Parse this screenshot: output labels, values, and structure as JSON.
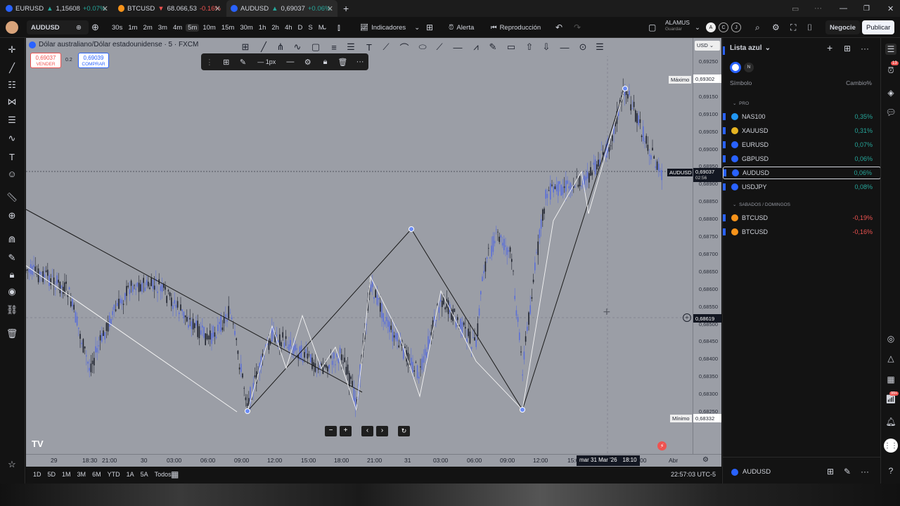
{
  "browser_tabs": [
    {
      "symbol": "EURUSD",
      "arrow": "▲",
      "price": "1,15608",
      "change": "+0.07%",
      "dir": "up"
    },
    {
      "symbol": "BTCUSD",
      "arrow": "▼",
      "price": "68.066,53",
      "change": "-0.16%",
      "dir": "down"
    },
    {
      "symbol": "AUDUSD",
      "arrow": "▲",
      "price": "0,69037",
      "change": "+0.06%",
      "dir": "up"
    }
  ],
  "toolbar": {
    "symbol": "AUDUSD",
    "timeframes": [
      "30s",
      "1m",
      "2m",
      "3m",
      "4m",
      "5m",
      "10m",
      "15m",
      "30m",
      "1h",
      "2h",
      "4h",
      "D",
      "S",
      "M"
    ],
    "selected_timeframe": "5m",
    "indicators_label": "Indicadores",
    "alert_label": "Alerta",
    "replay_label": "Reproducción",
    "layout_name": "ALAMUS",
    "layout_sub": "Guardar",
    "trade_label": "Negocie",
    "publish_label": "Publicar"
  },
  "chart": {
    "title": "Dólar australiano/Dólar estadounidense · 5 · FXCM",
    "sell_price": "0,69037",
    "sell_label": "VENDER",
    "spread": "0.2",
    "buy_price": "0,69039",
    "buy_label": "COMPRAR",
    "currency": "USD",
    "max_label": "Máximo",
    "max_value": "0,69302",
    "min_label": "Mínimo",
    "min_value": "0,68332",
    "current_symbol": "AUDUSD",
    "current_price": "0,69037",
    "countdown": "02:56",
    "crosshair_price": "0,68619",
    "line_width_label": "1px",
    "price_labels": [
      "0,69250",
      "0,69200",
      "0,69150",
      "0,69100",
      "0,69050",
      "0,69000",
      "0,68950",
      "0,68900",
      "0,68850",
      "0,68800",
      "0,68750",
      "0,68700",
      "0,68650",
      "0,68600",
      "0,68550",
      "0,68500",
      "0,68450",
      "0,68400",
      "0,68350",
      "0,68300",
      "0,68250"
    ],
    "time_labels": [
      "29",
      "18:30",
      "21:00",
      "30",
      "03:00",
      "06:00",
      "09:00",
      "12:00",
      "15:00",
      "18:00",
      "21:00",
      "31",
      "03:00",
      "06:00",
      "09:00",
      "12:00",
      "15:0",
      "00",
      "Abr"
    ],
    "crosshair_time": "mar 31 Mar '26",
    "crosshair_clock": "18:10"
  },
  "bottombar": {
    "ranges": [
      "1D",
      "5D",
      "1M",
      "3M",
      "6M",
      "YTD",
      "1A",
      "5A",
      "Todos"
    ],
    "clock": "22:57:03 UTC-5"
  },
  "watchlist": {
    "title": "Lista azul",
    "col_symbol": "Símbolo",
    "col_change": "Cambio%",
    "section1": "PRO",
    "section2": "SABADOS / DOMINGOS",
    "items": [
      {
        "symbol": "NAS100",
        "change": "0,35%",
        "dir": "up",
        "color": "#2196f3"
      },
      {
        "symbol": "XAUUSD",
        "change": "0,31%",
        "dir": "up",
        "color": "#e6b422"
      },
      {
        "symbol": "EURUSD",
        "change": "0,07%",
        "dir": "up",
        "color": "#2962ff"
      },
      {
        "symbol": "GBPUSD",
        "change": "0,06%",
        "dir": "up",
        "color": "#2962ff"
      },
      {
        "symbol": "AUDUSD",
        "change": "0,06%",
        "dir": "up",
        "color": "#2962ff"
      },
      {
        "symbol": "USDJPY",
        "change": "0,08%",
        "dir": "up",
        "color": "#2962ff"
      }
    ],
    "items2": [
      {
        "symbol": "BTCUSD",
        "change": "-0,19%",
        "dir": "down",
        "color": "#f7931a"
      },
      {
        "symbol": "BTCUSD",
        "change": "-0,16%",
        "dir": "down",
        "color": "#f7931a"
      }
    ],
    "footer_symbol": "AUDUSD",
    "badge_13": "13",
    "badge_99": "99+"
  },
  "colors": {
    "up": "#26a69a",
    "down": "#ef5350",
    "accent": "#2962ff",
    "chart_bg": "#9b9ea6"
  }
}
